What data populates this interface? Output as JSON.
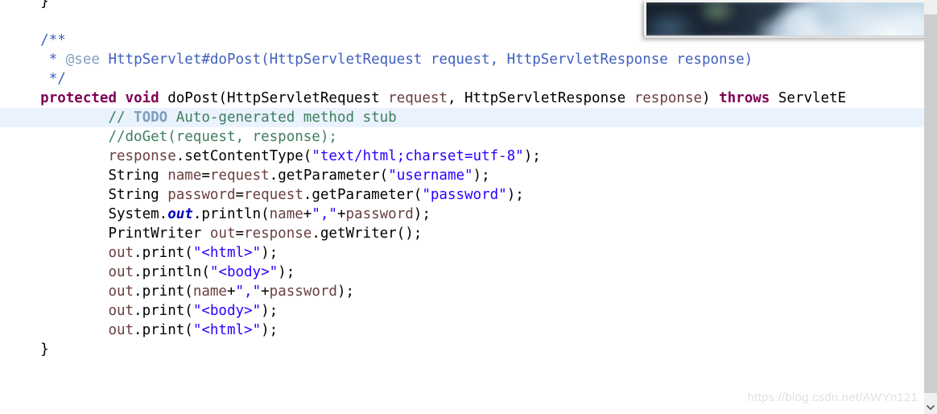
{
  "editor": {
    "language": "java",
    "current_line_index": 6,
    "lines": [
      {
        "indent": 1,
        "tokens": [
          {
            "t": "plain",
            "v": "}"
          }
        ]
      },
      {
        "indent": 0,
        "tokens": [
          {
            "t": "plain",
            "v": ""
          }
        ]
      },
      {
        "indent": 1,
        "tokens": [
          {
            "t": "jdoc",
            "v": "/**"
          }
        ]
      },
      {
        "indent": 1,
        "tokens": [
          {
            "t": "jdoc",
            "v": " * "
          },
          {
            "t": "jdoc-tag",
            "v": "@see"
          },
          {
            "t": "jdoc-lnk",
            "v": " HttpServlet#doPost(HttpServletRequest request, HttpServletResponse response)"
          }
        ]
      },
      {
        "indent": 1,
        "tokens": [
          {
            "t": "jdoc",
            "v": " */"
          }
        ]
      },
      {
        "indent": 1,
        "tokens": [
          {
            "t": "kw",
            "v": "protected"
          },
          {
            "t": "plain",
            "v": " "
          },
          {
            "t": "kw",
            "v": "void"
          },
          {
            "t": "plain",
            "v": " doPost(HttpServletRequest "
          },
          {
            "t": "param",
            "v": "request"
          },
          {
            "t": "plain",
            "v": ", HttpServletResponse "
          },
          {
            "t": "param",
            "v": "response"
          },
          {
            "t": "plain",
            "v": ") "
          },
          {
            "t": "kw",
            "v": "throws"
          },
          {
            "t": "plain",
            "v": " ServletE"
          }
        ]
      },
      {
        "indent": 3,
        "tokens": [
          {
            "t": "cmt",
            "v": "// "
          },
          {
            "t": "todo",
            "v": "TODO"
          },
          {
            "t": "cmt",
            "v": " Auto-generated method stub"
          }
        ]
      },
      {
        "indent": 3,
        "tokens": [
          {
            "t": "cmt",
            "v": "//doGet(request, response);"
          }
        ]
      },
      {
        "indent": 3,
        "tokens": [
          {
            "t": "param",
            "v": "response"
          },
          {
            "t": "plain",
            "v": ".setContentType("
          },
          {
            "t": "str",
            "v": "\"text/html;charset=utf-8\""
          },
          {
            "t": "plain",
            "v": ");"
          }
        ]
      },
      {
        "indent": 3,
        "tokens": [
          {
            "t": "plain",
            "v": "String "
          },
          {
            "t": "param",
            "v": "name"
          },
          {
            "t": "plain",
            "v": "="
          },
          {
            "t": "param",
            "v": "request"
          },
          {
            "t": "plain",
            "v": ".getParameter("
          },
          {
            "t": "str",
            "v": "\"username\""
          },
          {
            "t": "plain",
            "v": ");"
          }
        ]
      },
      {
        "indent": 3,
        "tokens": [
          {
            "t": "plain",
            "v": "String "
          },
          {
            "t": "param",
            "v": "password"
          },
          {
            "t": "plain",
            "v": "="
          },
          {
            "t": "param",
            "v": "request"
          },
          {
            "t": "plain",
            "v": ".getParameter("
          },
          {
            "t": "str",
            "v": "\"password\""
          },
          {
            "t": "plain",
            "v": ");"
          }
        ]
      },
      {
        "indent": 3,
        "tokens": [
          {
            "t": "plain",
            "v": "System."
          },
          {
            "t": "field",
            "v": "out"
          },
          {
            "t": "plain",
            "v": ".println("
          },
          {
            "t": "param",
            "v": "name"
          },
          {
            "t": "plain",
            "v": "+"
          },
          {
            "t": "str",
            "v": "\",\""
          },
          {
            "t": "plain",
            "v": "+"
          },
          {
            "t": "param",
            "v": "password"
          },
          {
            "t": "plain",
            "v": ");"
          }
        ]
      },
      {
        "indent": 3,
        "tokens": [
          {
            "t": "plain",
            "v": "PrintWriter "
          },
          {
            "t": "param",
            "v": "out"
          },
          {
            "t": "plain",
            "v": "="
          },
          {
            "t": "param",
            "v": "response"
          },
          {
            "t": "plain",
            "v": ".getWriter();"
          }
        ]
      },
      {
        "indent": 3,
        "tokens": [
          {
            "t": "param",
            "v": "out"
          },
          {
            "t": "plain",
            "v": ".print("
          },
          {
            "t": "str",
            "v": "\"<html>\""
          },
          {
            "t": "plain",
            "v": ");"
          }
        ]
      },
      {
        "indent": 3,
        "tokens": [
          {
            "t": "param",
            "v": "out"
          },
          {
            "t": "plain",
            "v": ".println("
          },
          {
            "t": "str",
            "v": "\"<body>\""
          },
          {
            "t": "plain",
            "v": ");"
          }
        ]
      },
      {
        "indent": 3,
        "tokens": [
          {
            "t": "param",
            "v": "out"
          },
          {
            "t": "plain",
            "v": ".print("
          },
          {
            "t": "param",
            "v": "name"
          },
          {
            "t": "plain",
            "v": "+"
          },
          {
            "t": "str",
            "v": "\",\""
          },
          {
            "t": "plain",
            "v": "+"
          },
          {
            "t": "param",
            "v": "password"
          },
          {
            "t": "plain",
            "v": ");"
          }
        ]
      },
      {
        "indent": 3,
        "tokens": [
          {
            "t": "param",
            "v": "out"
          },
          {
            "t": "plain",
            "v": ".print("
          },
          {
            "t": "str",
            "v": "\"<body>\""
          },
          {
            "t": "plain",
            "v": ");"
          }
        ]
      },
      {
        "indent": 3,
        "tokens": [
          {
            "t": "param",
            "v": "out"
          },
          {
            "t": "plain",
            "v": ".print("
          },
          {
            "t": "str",
            "v": "\"<html>\""
          },
          {
            "t": "plain",
            "v": ");"
          }
        ]
      },
      {
        "indent": 1,
        "tokens": [
          {
            "t": "plain",
            "v": "}"
          }
        ]
      }
    ]
  },
  "video_overlay": {
    "description": "blurred-video-thumbnail",
    "alt": "blurred person in light blue garment"
  },
  "watermark": {
    "text": "https://blog.csdn.net/AWYn121"
  },
  "scrollbar": {
    "down_arrow_icon": "chevron-down-icon"
  },
  "colors": {
    "background": "#ffffff",
    "current_line": "#e9f2fd",
    "keyword": "#7f0055",
    "string": "#2a00ff",
    "comment": "#3f7f5f",
    "todo_tag": "#7f9fbf",
    "javadoc": "#3f5fbf",
    "parameter": "#6a3e3e",
    "static_field": "#0000c0",
    "plain_text": "#000000",
    "watermark": "#e2e2e2",
    "scrollbar_thumb": "#cdcdcd",
    "scrollbar_track": "#f0f0f0"
  }
}
